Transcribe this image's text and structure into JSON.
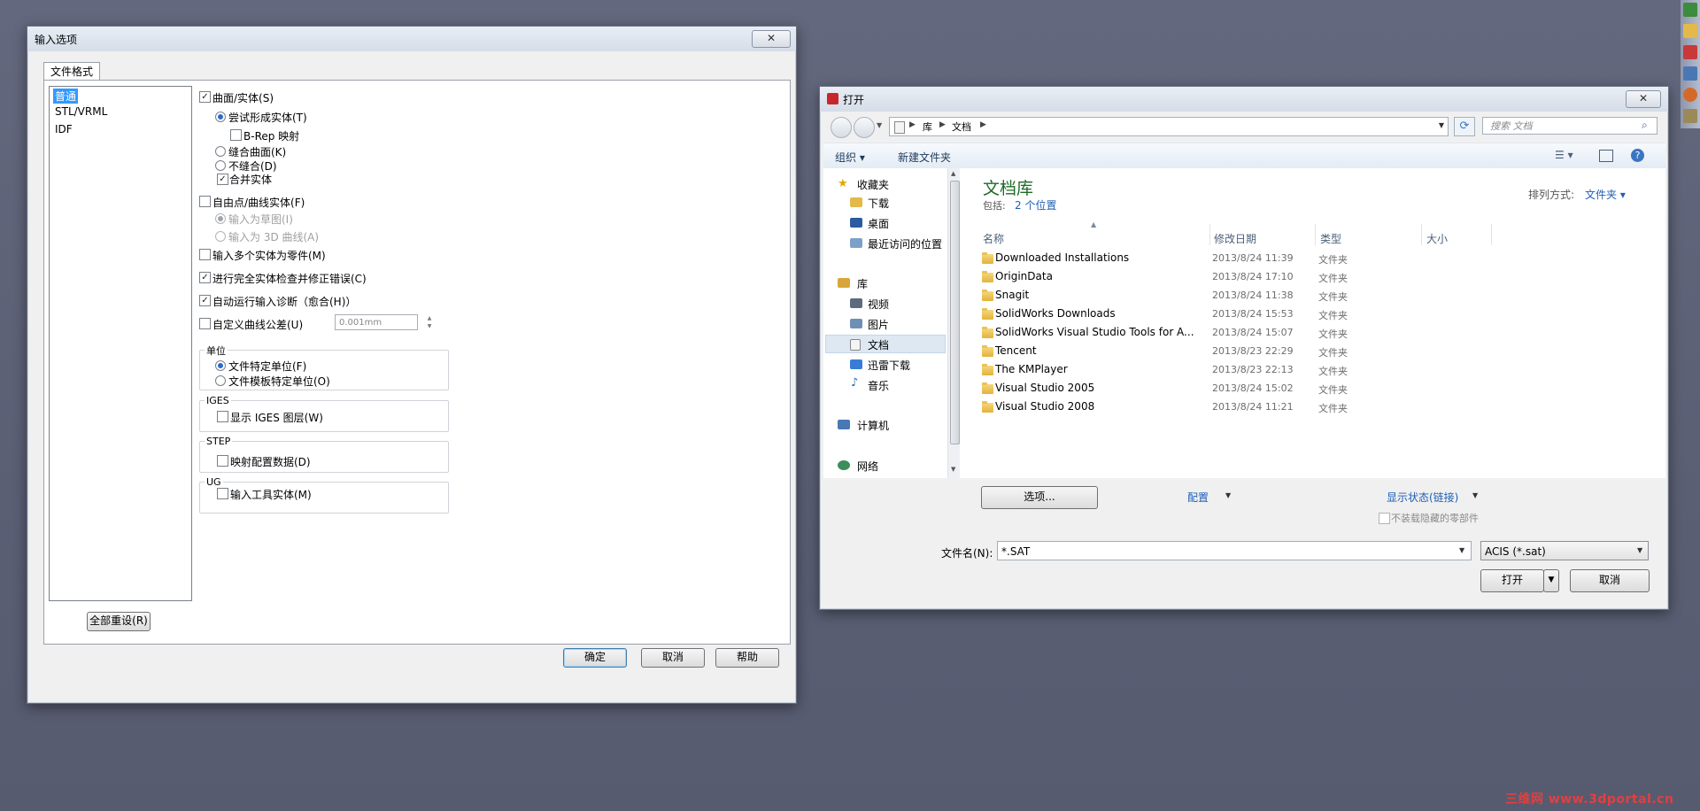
{
  "input_dialog": {
    "title": "输入选项",
    "close_label": "✕",
    "tab_label": "文件格式",
    "format_list": [
      "普通",
      "STL/VRML",
      "IDF"
    ],
    "options": {
      "surfaces_solids": "曲面/实体(S)",
      "try_form_solid": "尝试形成实体(T)",
      "brep_mapping": "B-Rep 映射",
      "knit_surfaces": "缝合曲面(K)",
      "no_knit": "不缝合(D)",
      "merge_solids": "合并实体",
      "free_point_curve": "自由点/曲线实体(F)",
      "import_as_sketch": "输入为草图(I)",
      "import_as_3d_curve": "输入为 3D 曲线(A)",
      "multi_body_as_part": "输入多个实体为零件(M)",
      "full_check": "进行完全实体检查并修正错误(C)",
      "auto_diagnose": "自动运行输入诊断（愈合(H)）",
      "custom_tolerance": "自定义曲线公差(U)",
      "tolerance_value": "0.001mm"
    },
    "groups": {
      "units_title": "单位",
      "file_units": "文件特定单位(F)",
      "template_units": "文件模板特定单位(O)",
      "iges_title": "IGES",
      "show_iges_layers": "显示 IGES 图层(W)",
      "step_title": "STEP",
      "map_config": "映射配置数据(D)",
      "ug_title": "UG",
      "import_tool_bodies": "输入工具实体(M)"
    },
    "reset_all": "全部重设(R)",
    "ok": "确定",
    "cancel": "取消",
    "help": "帮助"
  },
  "open_dialog": {
    "title": "打开",
    "close_label": "✕",
    "breadcrumb": [
      "库",
      "文档"
    ],
    "search_placeholder": "搜索 文档",
    "toolbar": {
      "organize": "组织 ▾",
      "new_folder": "新建文件夹"
    },
    "nav": {
      "favorites": "收藏夹",
      "downloads": "下载",
      "desktop": "桌面",
      "recent": "最近访问的位置",
      "libraries": "库",
      "videos": "视频",
      "pictures": "图片",
      "documents": "文档",
      "thunder": "迅雷下载",
      "music": "音乐",
      "computer": "计算机",
      "network": "网络"
    },
    "library_title": "文档库",
    "includes_label": "包括:",
    "includes_link": "2 个位置",
    "arrange_label": "排列方式:",
    "arrange_value": "文件夹 ▾",
    "columns": [
      "名称",
      "修改日期",
      "类型",
      "大小"
    ],
    "files": [
      {
        "name": "Downloaded Installations",
        "date": "2013/8/24 11:39",
        "type": "文件夹"
      },
      {
        "name": "OriginData",
        "date": "2013/8/24 17:10",
        "type": "文件夹"
      },
      {
        "name": "Snagit",
        "date": "2013/8/24 11:38",
        "type": "文件夹"
      },
      {
        "name": "SolidWorks Downloads",
        "date": "2013/8/24 15:53",
        "type": "文件夹"
      },
      {
        "name": "SolidWorks Visual Studio Tools for A...",
        "date": "2013/8/24 15:07",
        "type": "文件夹"
      },
      {
        "name": "Tencent",
        "date": "2013/8/23 22:29",
        "type": "文件夹"
      },
      {
        "name": "The KMPlayer",
        "date": "2013/8/23 22:13",
        "type": "文件夹"
      },
      {
        "name": "Visual Studio 2005",
        "date": "2013/8/24 15:02",
        "type": "文件夹"
      },
      {
        "name": "Visual Studio 2008",
        "date": "2013/8/24 11:21",
        "type": "文件夹"
      }
    ],
    "options_button": "选项...",
    "config_label": "配置",
    "display_state": "显示状态(链接)",
    "no_load_hidden": "不装载隐藏的零部件",
    "filename_label": "文件名(N):",
    "filename_value": "*.SAT",
    "filetype_value": "ACIS (*.sat)",
    "open_button": "打开",
    "cancel_button": "取消"
  },
  "watermark": "三维网 www.3dportal.cn"
}
